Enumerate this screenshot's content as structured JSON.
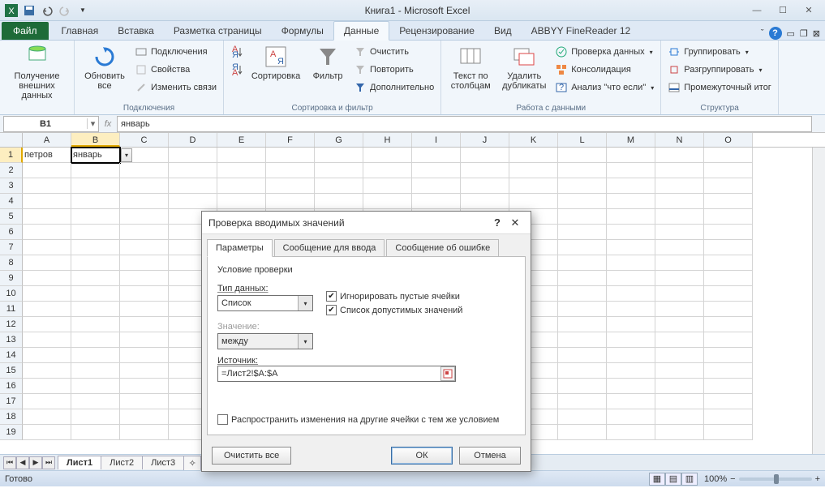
{
  "title": "Книга1 - Microsoft Excel",
  "file_tab": "Файл",
  "tabs": [
    "Главная",
    "Вставка",
    "Разметка страницы",
    "Формулы",
    "Данные",
    "Рецензирование",
    "Вид",
    "ABBYY FineReader 12"
  ],
  "active_tab": "Данные",
  "ribbon": {
    "g1": {
      "btn": "Получение\nвнешних данных",
      "label": ""
    },
    "g2": {
      "btn": "Обновить\nвсе",
      "items": [
        "Подключения",
        "Свойства",
        "Изменить связи"
      ],
      "label": "Подключения"
    },
    "g3": {
      "sort": "Сортировка",
      "filter": "Фильтр",
      "items": [
        "Очистить",
        "Повторить",
        "Дополнительно"
      ],
      "label": "Сортировка и фильтр"
    },
    "g4": {
      "b1": "Текст по\nстолбцам",
      "b2": "Удалить\nдубликаты",
      "items": [
        "Проверка данных",
        "Консолидация",
        "Анализ \"что если\""
      ],
      "label": "Работа с данными"
    },
    "g5": {
      "items": [
        "Группировать",
        "Разгруппировать",
        "Промежуточный итог"
      ],
      "label": "Структура"
    }
  },
  "namebox": "B1",
  "formula": "январь",
  "cols": [
    "A",
    "B",
    "C",
    "D",
    "E",
    "F",
    "G",
    "H",
    "I",
    "J",
    "K",
    "L",
    "M",
    "N",
    "O"
  ],
  "active_col": "B",
  "active_row": 1,
  "cells": {
    "A1": "петров",
    "B1": "январь"
  },
  "sheets": [
    "Лист1",
    "Лист2",
    "Лист3"
  ],
  "active_sheet": "Лист1",
  "status": "Готово",
  "zoom": "100%",
  "dialog": {
    "title": "Проверка вводимых значений",
    "tabs": [
      "Параметры",
      "Сообщение для ввода",
      "Сообщение об ошибке"
    ],
    "active_tab": "Параметры",
    "section": "Условие проверки",
    "type_label": "Тип данных:",
    "type_value": "Список",
    "value_label": "Значение:",
    "value_value": "между",
    "chk_ignore": "Игнорировать пустые ячейки",
    "chk_list": "Список допустимых значений",
    "src_label": "Источник:",
    "src_value": "=Лист2!$A:$A",
    "chk_propagate": "Распространить изменения на другие ячейки с тем же условием",
    "btn_clear": "Очистить все",
    "btn_ok": "ОК",
    "btn_cancel": "Отмена"
  }
}
